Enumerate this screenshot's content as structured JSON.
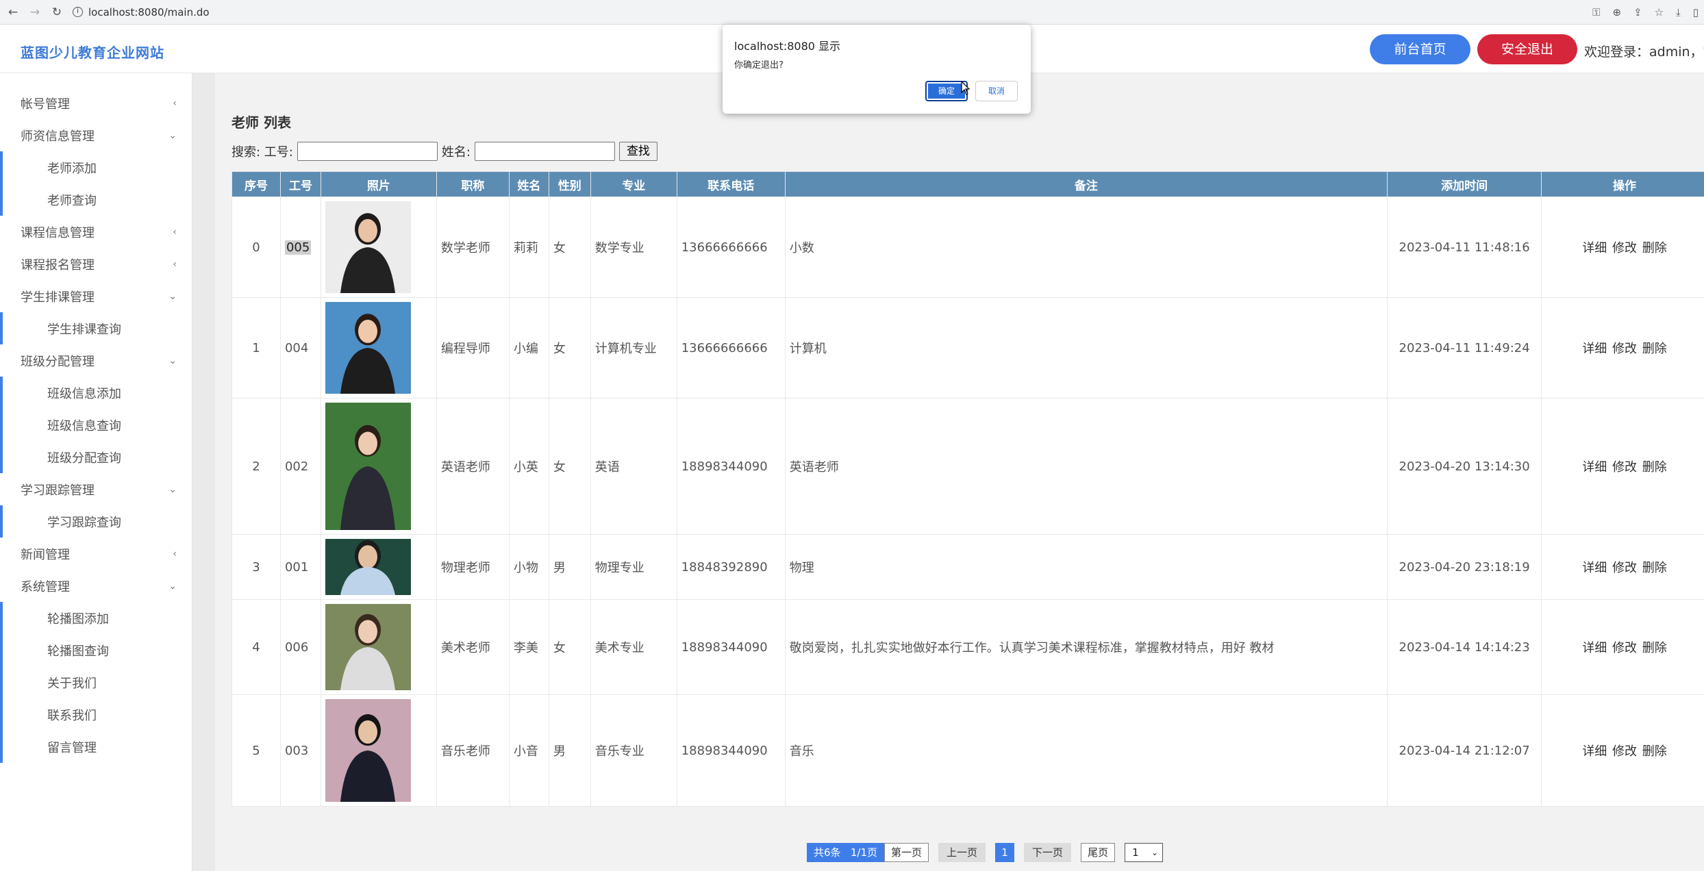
{
  "browser": {
    "url": "localhost:8080/main.do"
  },
  "header": {
    "brand": "蓝图少儿教育企业网站",
    "home_button": "前台首页",
    "logout_button": "安全退出",
    "welcome": "欢迎登录：admin，管"
  },
  "sidebar": {
    "items": [
      {
        "label": "帐号管理",
        "type": "group",
        "arrow": "‹"
      },
      {
        "label": "师资信息管理",
        "type": "group",
        "arrow": "⌄"
      },
      {
        "label": "老师添加",
        "type": "sub"
      },
      {
        "label": "老师查询",
        "type": "sub"
      },
      {
        "label": "课程信息管理",
        "type": "group",
        "arrow": "‹"
      },
      {
        "label": "课程报名管理",
        "type": "group",
        "arrow": "‹"
      },
      {
        "label": "学生排课管理",
        "type": "group",
        "arrow": "⌄"
      },
      {
        "label": "学生排课查询",
        "type": "sub"
      },
      {
        "label": "班级分配管理",
        "type": "group",
        "arrow": "⌄"
      },
      {
        "label": "班级信息添加",
        "type": "sub"
      },
      {
        "label": "班级信息查询",
        "type": "sub"
      },
      {
        "label": "班级分配查询",
        "type": "sub"
      },
      {
        "label": "学习跟踪管理",
        "type": "group",
        "arrow": "⌄"
      },
      {
        "label": "学习跟踪查询",
        "type": "sub"
      },
      {
        "label": "新闻管理",
        "type": "group",
        "arrow": "‹"
      },
      {
        "label": "系统管理",
        "type": "group",
        "arrow": "⌄"
      },
      {
        "label": "轮播图添加",
        "type": "sub"
      },
      {
        "label": "轮播图查询",
        "type": "sub"
      },
      {
        "label": "关于我们",
        "type": "sub"
      },
      {
        "label": "联系我们",
        "type": "sub"
      },
      {
        "label": "留言管理",
        "type": "sub"
      }
    ]
  },
  "main": {
    "title": "老师 列表",
    "search": {
      "prefix": "搜索: 工号:",
      "name_label": "姓名:",
      "button": "查找",
      "id_value": "",
      "name_value": ""
    },
    "columns": [
      "序号",
      "工号",
      "照片",
      "职称",
      "姓名",
      "性别",
      "专业",
      "联系电话",
      "备注",
      "添加时间",
      "操作"
    ],
    "rows": [
      {
        "idx": "0",
        "id": "005",
        "title": "数学老师",
        "name": "莉莉",
        "gender": "女",
        "major": "数学专业",
        "phone": "13666666666",
        "note": "小数",
        "time": "2023-04-11 11:48:16"
      },
      {
        "idx": "1",
        "id": "004",
        "title": "编程导师",
        "name": "小编",
        "gender": "女",
        "major": "计算机专业",
        "phone": "13666666666",
        "note": "计算机",
        "time": "2023-04-11 11:49:24"
      },
      {
        "idx": "2",
        "id": "002",
        "title": "英语老师",
        "name": "小英",
        "gender": "女",
        "major": "英语",
        "phone": "18898344090",
        "note": "英语老师",
        "time": "2023-04-20 13:14:30"
      },
      {
        "idx": "3",
        "id": "001",
        "title": "物理老师",
        "name": "小物",
        "gender": "男",
        "major": "物理专业",
        "phone": "18848392890",
        "note": "物理",
        "time": "2023-04-20 23:18:19"
      },
      {
        "idx": "4",
        "id": "006",
        "title": "美术老师",
        "name": "李美",
        "gender": "女",
        "major": "美术专业",
        "phone": "18898344090",
        "note": "敬岗爱岗，扎扎实实地做好本行工作。认真学习美术课程标准，掌握教材特点，用好 教材",
        "time": "2023-04-14 14:14:23"
      },
      {
        "idx": "5",
        "id": "003",
        "title": "音乐老师",
        "name": "小音",
        "gender": "男",
        "major": "音乐专业",
        "phone": "18898344090",
        "note": "音乐",
        "time": "2023-04-14 21:12:07"
      }
    ],
    "ops": {
      "detail": "详细",
      "edit": "修改",
      "delete": "删除"
    },
    "pager": {
      "total": "共6条",
      "pages": "1/1页",
      "first": "第一页",
      "prev": "上一页",
      "current": "1",
      "next": "下一页",
      "last": "尾页",
      "select_value": "1"
    }
  },
  "dialog": {
    "title": "localhost:8080 显示",
    "message": "你确定退出?",
    "ok": "确定",
    "cancel": "取消"
  }
}
